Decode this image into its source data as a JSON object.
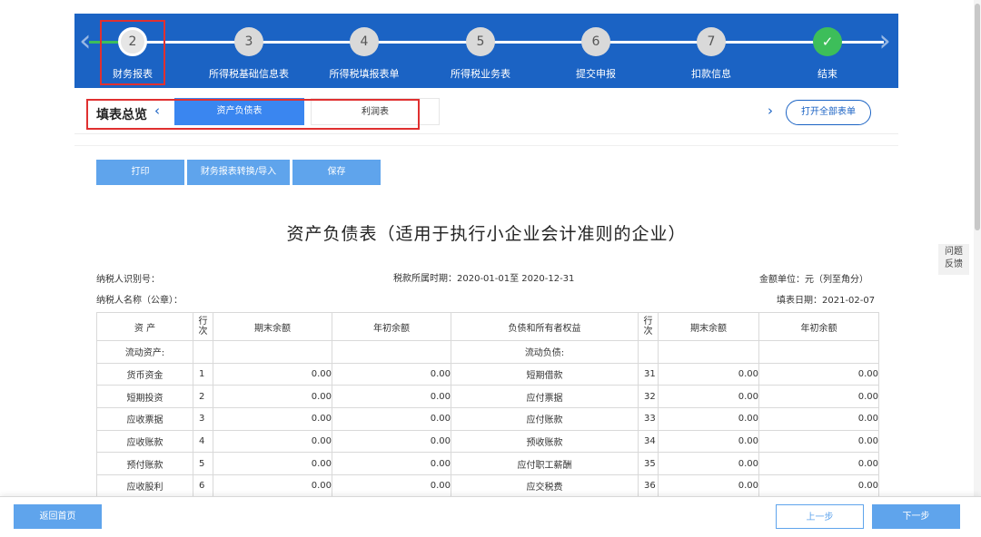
{
  "colors": {
    "banner": "#1b63c4",
    "accent": "#3a86f0",
    "button": "#5fa4ec",
    "done": "#3dbe5a",
    "highlight": "#e03030"
  },
  "stepper": {
    "steps": [
      {
        "number": "2",
        "label": "财务报表",
        "state": "current"
      },
      {
        "number": "3",
        "label": "所得税基础信息表",
        "state": "pending"
      },
      {
        "number": "4",
        "label": "所得税填报表单",
        "state": "pending"
      },
      {
        "number": "5",
        "label": "所得税业务表",
        "state": "pending"
      },
      {
        "number": "6",
        "label": "提交申报",
        "state": "pending"
      },
      {
        "number": "7",
        "label": "扣款信息",
        "state": "pending"
      },
      {
        "number": "✓",
        "label": "结束",
        "state": "done"
      }
    ],
    "left_arrow": "‹",
    "right_arrow": "›"
  },
  "tabbar": {
    "title": "填表总览",
    "prev_arrow": "‹",
    "next_arrow": "›",
    "tabs": [
      {
        "label": "资产负债表",
        "active": true
      },
      {
        "label": "利润表",
        "active": false
      }
    ],
    "open_all": "打开全部表单"
  },
  "toolbar": {
    "print": "打印",
    "convert_import": "财务报表转换/导入",
    "save": "保存"
  },
  "report": {
    "title": "资产负债表（适用于执行小企业会计准则的企业）",
    "taxpayer_id_label": "纳税人识别号：",
    "period": "税款所属时期：2020-01-01至 2020-12-31",
    "unit": "金额单位：元（列至角分）",
    "taxpayer_name_label": "纳税人名称（公章）：",
    "fill_date": "填表日期：2021-02-07"
  },
  "table": {
    "headers": [
      "资 产",
      "行次",
      "期末余额",
      "年初余额",
      "负债和所有者权益",
      "行次",
      "期末余额",
      "年初余额"
    ],
    "section_row": {
      "left": "流动资产:",
      "right": "流动负债:"
    },
    "rows": [
      {
        "asset": "货币资金",
        "no": "1",
        "end": "0.00",
        "begin": "0.00",
        "liab": "短期借款",
        "lno": "31",
        "lend": "0.00",
        "lbegin": "0.00"
      },
      {
        "asset": "短期投资",
        "no": "2",
        "end": "0.00",
        "begin": "0.00",
        "liab": "应付票据",
        "lno": "32",
        "lend": "0.00",
        "lbegin": "0.00"
      },
      {
        "asset": "应收票据",
        "no": "3",
        "end": "0.00",
        "begin": "0.00",
        "liab": "应付账款",
        "lno": "33",
        "lend": "0.00",
        "lbegin": "0.00"
      },
      {
        "asset": "应收账款",
        "no": "4",
        "end": "0.00",
        "begin": "0.00",
        "liab": "预收账款",
        "lno": "34",
        "lend": "0.00",
        "lbegin": "0.00"
      },
      {
        "asset": "预付账款",
        "no": "5",
        "end": "0.00",
        "begin": "0.00",
        "liab": "应付职工薪酬",
        "lno": "35",
        "lend": "0.00",
        "lbegin": "0.00"
      },
      {
        "asset": "应收股利",
        "no": "6",
        "end": "0.00",
        "begin": "0.00",
        "liab": "应交税费",
        "lno": "36",
        "lend": "0.00",
        "lbegin": "0.00"
      }
    ]
  },
  "feedback": {
    "line1": "问题",
    "line2": "反馈"
  },
  "bottom": {
    "home": "返回首页",
    "prev": "上一步",
    "next": "下一步"
  }
}
